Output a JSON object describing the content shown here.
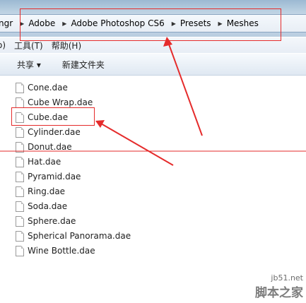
{
  "address_bar": {
    "crumbs": [
      "ngr",
      "Adobe",
      "Adobe Photoshop CS6",
      "Presets",
      "Meshes"
    ]
  },
  "menu": {
    "items": [
      "o)",
      "工具(T)",
      "帮助(H)"
    ]
  },
  "toolbar": {
    "share_label": "共享 ▾",
    "new_folder_label": "新建文件夹"
  },
  "files": [
    "Cone.dae",
    "Cube Wrap.dae",
    "Cube.dae",
    "Cylinder.dae",
    "Donut.dae",
    "Hat.dae",
    "Pyramid.dae",
    "Ring.dae",
    "Soda.dae",
    "Sphere.dae",
    "Spherical Panorama.dae",
    "Wine Bottle.dae"
  ],
  "watermark": {
    "url": "jb51.net",
    "name": "脚本之家"
  },
  "colors": {
    "annotation": "#e52b2b"
  }
}
